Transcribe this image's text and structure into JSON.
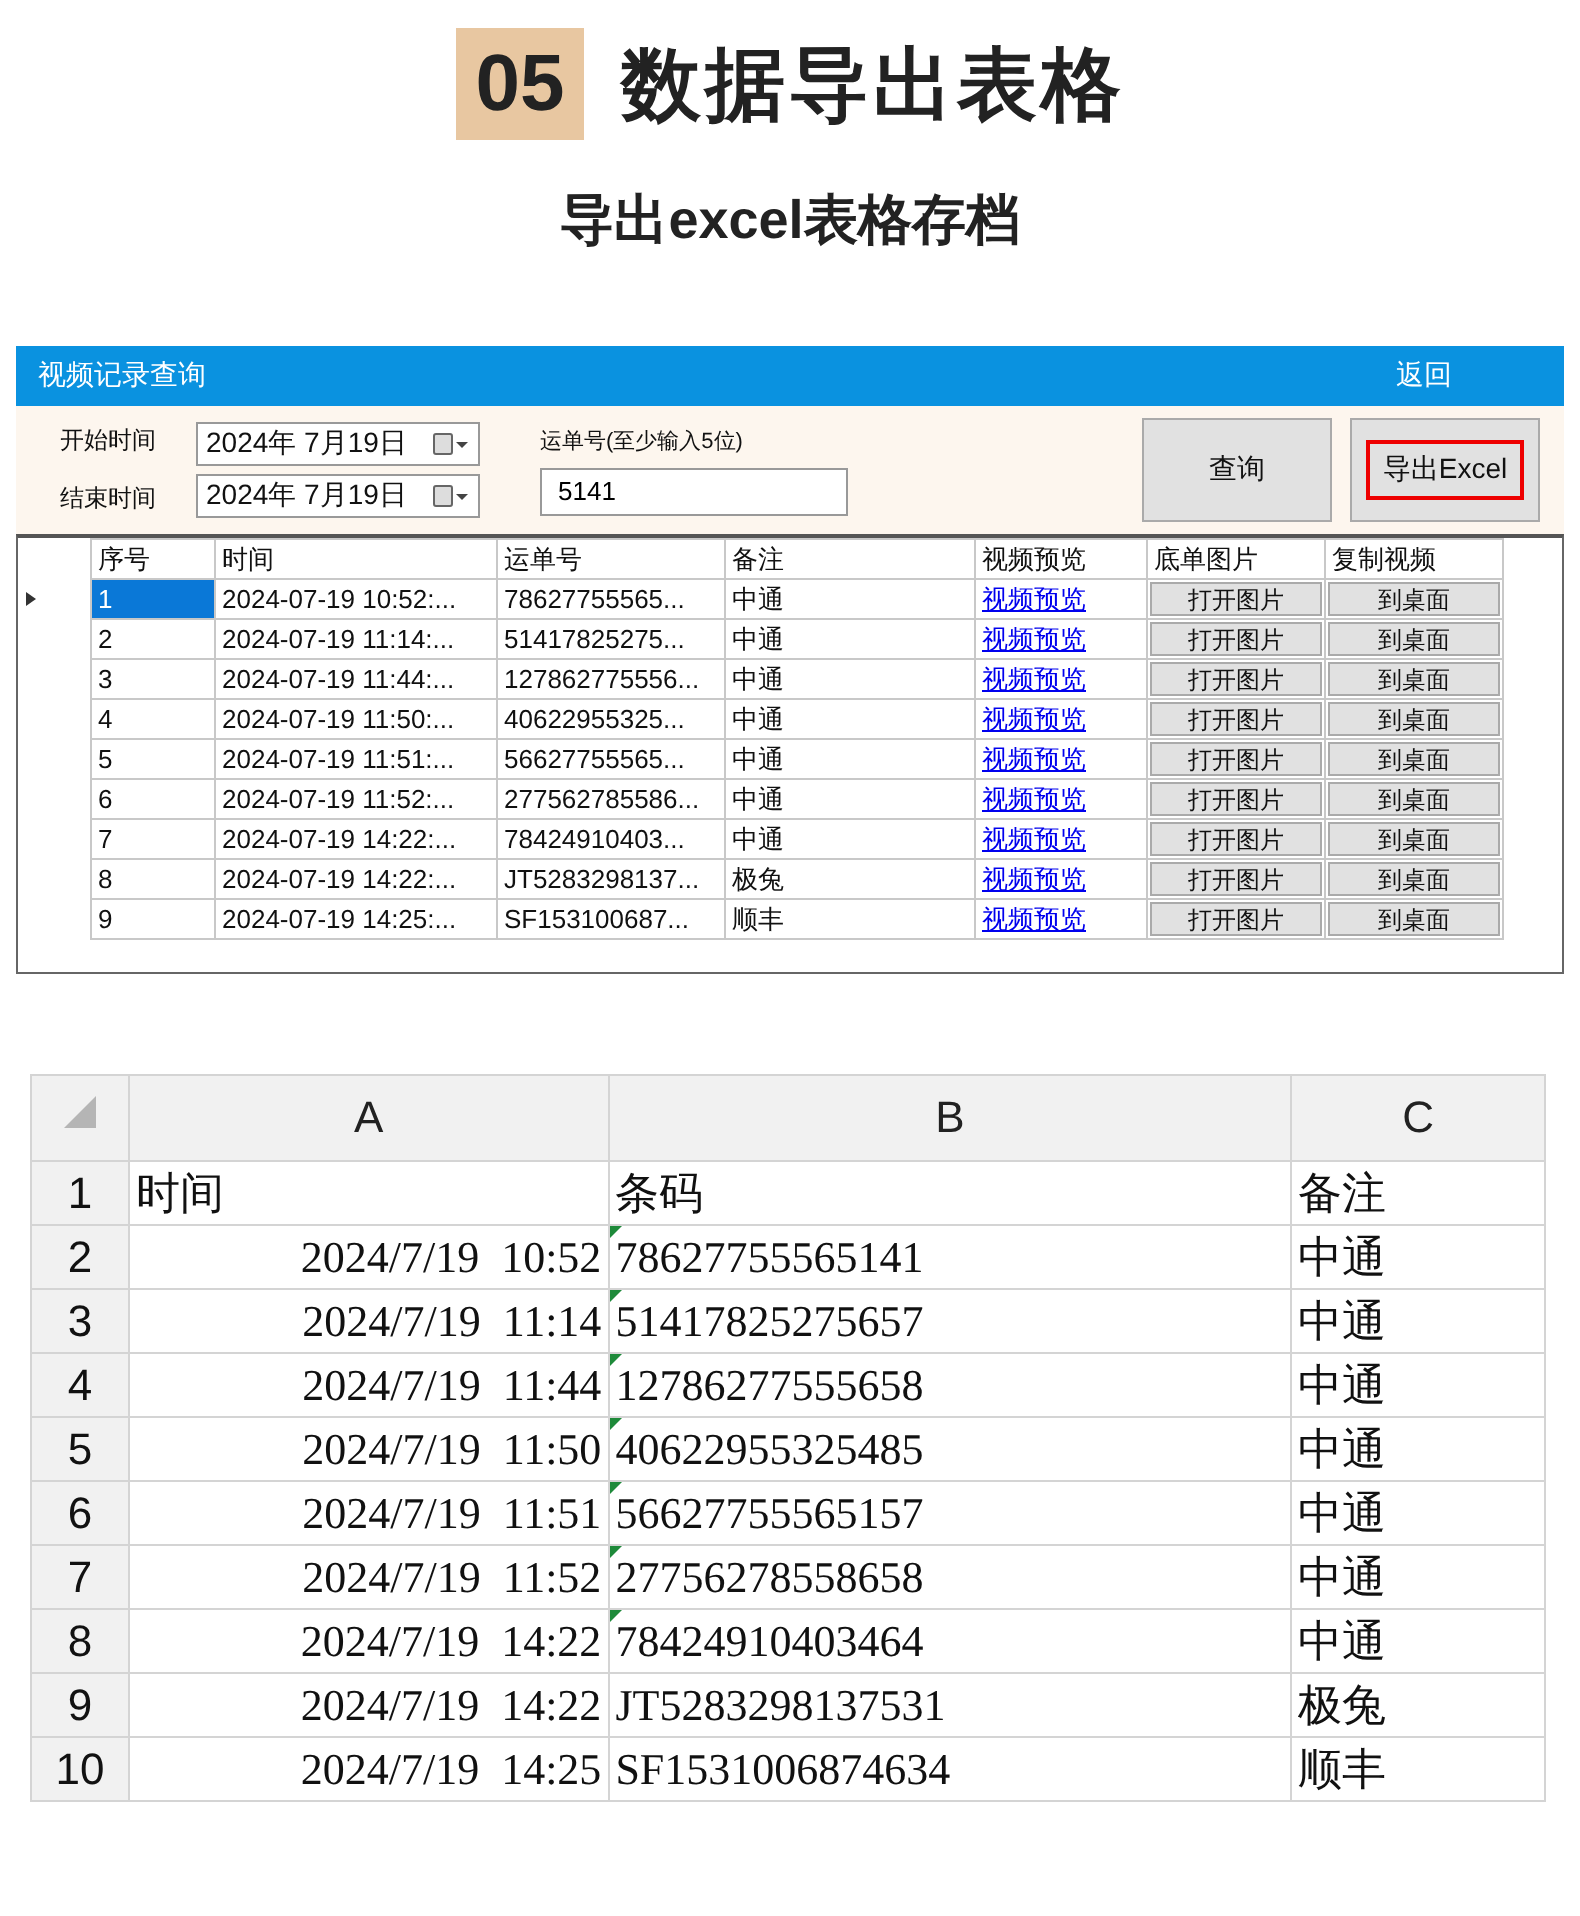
{
  "heading": {
    "number": "05",
    "title": "数据导出表格",
    "subtitle": "导出excel表格存档"
  },
  "app": {
    "title": "视频记录查询",
    "back": "返回",
    "start_label": "开始时间",
    "start_value": "2024年  7月19日",
    "end_label": "结束时间",
    "end_value": "2024年  7月19日",
    "waybill_label": "运单号(至少输入5位)",
    "waybill_value": "5141",
    "buttons": [
      {
        "label": "查询",
        "highlighted": false
      },
      {
        "label": "导出Excel",
        "highlighted": true
      }
    ],
    "columns": [
      "序号",
      "时间",
      "运单号",
      "备注",
      "视频预览",
      "底单图片",
      "复制视频"
    ],
    "rows": [
      {
        "selected": true,
        "no": "1",
        "time": "2024-07-19 10:52:...",
        "waybill": "78627755565...",
        "note": "中通",
        "preview": "视频预览",
        "image": "打开图片",
        "copy": "到桌面"
      },
      {
        "selected": false,
        "no": "2",
        "time": "2024-07-19 11:14:...",
        "waybill": "51417825275...",
        "note": "中通",
        "preview": "视频预览",
        "image": "打开图片",
        "copy": "到桌面"
      },
      {
        "selected": false,
        "no": "3",
        "time": "2024-07-19 11:44:...",
        "waybill": "127862775556...",
        "note": "中通",
        "preview": "视频预览",
        "image": "打开图片",
        "copy": "到桌面"
      },
      {
        "selected": false,
        "no": "4",
        "time": "2024-07-19 11:50:...",
        "waybill": "40622955325...",
        "note": "中通",
        "preview": "视频预览",
        "image": "打开图片",
        "copy": "到桌面"
      },
      {
        "selected": false,
        "no": "5",
        "time": "2024-07-19 11:51:...",
        "waybill": "56627755565...",
        "note": "中通",
        "preview": "视频预览",
        "image": "打开图片",
        "copy": "到桌面"
      },
      {
        "selected": false,
        "no": "6",
        "time": "2024-07-19 11:52:...",
        "waybill": "277562785586...",
        "note": "中通",
        "preview": "视频预览",
        "image": "打开图片",
        "copy": "到桌面"
      },
      {
        "selected": false,
        "no": "7",
        "time": "2024-07-19 14:22:...",
        "waybill": "78424910403...",
        "note": "中通",
        "preview": "视频预览",
        "image": "打开图片",
        "copy": "到桌面"
      },
      {
        "selected": false,
        "no": "8",
        "time": "2024-07-19 14:22:...",
        "waybill": "JT5283298137...",
        "note": "极兔",
        "preview": "视频预览",
        "image": "打开图片",
        "copy": "到桌面"
      },
      {
        "selected": false,
        "no": "9",
        "time": "2024-07-19 14:25:...",
        "waybill": "SF153100687...",
        "note": "顺丰",
        "preview": "视频预览",
        "image": "打开图片",
        "copy": "到桌面"
      }
    ]
  },
  "sheet": {
    "columns": [
      "A",
      "B",
      "C"
    ],
    "rows": [
      {
        "number": "1",
        "kind": "label",
        "flag": false,
        "cells": [
          "时间",
          "条码",
          "备注"
        ]
      },
      {
        "number": "2",
        "kind": "data",
        "flag": true,
        "cells": [
          "2024/7/19  10:52",
          "78627755565141",
          "中通"
        ]
      },
      {
        "number": "3",
        "kind": "data",
        "flag": true,
        "cells": [
          "2024/7/19  11:14",
          "51417825275657",
          "中通"
        ]
      },
      {
        "number": "4",
        "kind": "data",
        "flag": true,
        "cells": [
          "2024/7/19  11:44",
          "12786277555658",
          "中通"
        ]
      },
      {
        "number": "5",
        "kind": "data",
        "flag": true,
        "cells": [
          "2024/7/19  11:50",
          "40622955325485",
          "中通"
        ]
      },
      {
        "number": "6",
        "kind": "data",
        "flag": true,
        "cells": [
          "2024/7/19  11:51",
          "56627755565157",
          "中通"
        ]
      },
      {
        "number": "7",
        "kind": "data",
        "flag": true,
        "cells": [
          "2024/7/19  11:52",
          "27756278558658",
          "中通"
        ]
      },
      {
        "number": "8",
        "kind": "data",
        "flag": true,
        "cells": [
          "2024/7/19  14:22",
          "78424910403464",
          "中通"
        ]
      },
      {
        "number": "9",
        "kind": "data",
        "flag": false,
        "cells": [
          "2024/7/19  14:22",
          "JT5283298137531",
          "极兔"
        ]
      },
      {
        "number": "10",
        "kind": "data",
        "flag": false,
        "cells": [
          "2024/7/19  14:25",
          "SF1531006874634",
          "顺丰"
        ]
      }
    ]
  }
}
